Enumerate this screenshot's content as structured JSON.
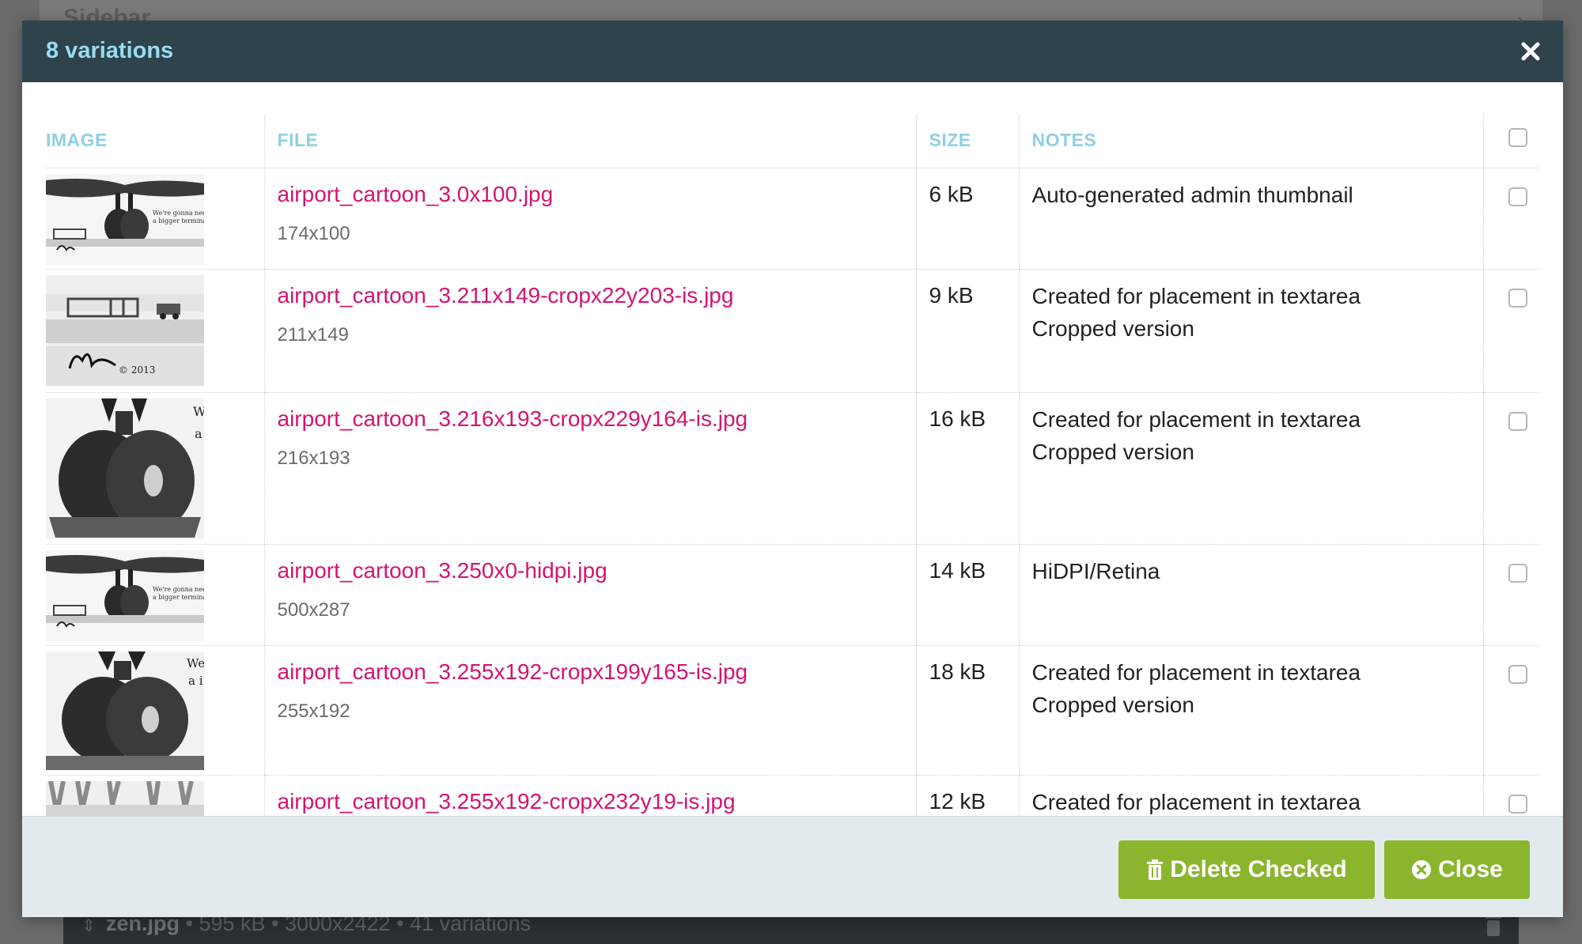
{
  "background": {
    "sidebar_label": "Sidebar",
    "file_name": "zen.jpg",
    "file_meta": "• 595 kB • 3000x2422 • 41 variations"
  },
  "modal": {
    "title": "8 variations",
    "columns": {
      "image": "IMAGE",
      "file": "FILE",
      "size": "SIZE",
      "notes": "NOTES"
    },
    "rows": [
      {
        "file": "airport_cartoon_3.0x100.jpg",
        "dims": "174x100",
        "size": "6 kB",
        "note1": "Auto-generated admin thumbnail",
        "note2": ""
      },
      {
        "file": "airport_cartoon_3.211x149-cropx22y203-is.jpg",
        "dims": "211x149",
        "size": "9 kB",
        "note1": "Created for placement in textarea",
        "note2": "Cropped version"
      },
      {
        "file": "airport_cartoon_3.216x193-cropx229y164-is.jpg",
        "dims": "216x193",
        "size": "16 kB",
        "note1": "Created for placement in textarea",
        "note2": "Cropped version"
      },
      {
        "file": "airport_cartoon_3.250x0-hidpi.jpg",
        "dims": "500x287",
        "size": "14 kB",
        "note1": "HiDPI/Retina",
        "note2": ""
      },
      {
        "file": "airport_cartoon_3.255x192-cropx199y165-is.jpg",
        "dims": "255x192",
        "size": "18 kB",
        "note1": "Created for placement in textarea",
        "note2": "Cropped version"
      },
      {
        "file": "airport_cartoon_3.255x192-cropx232y19-is.jpg",
        "dims": "",
        "size": "12 kB",
        "note1": "Created for placement in textarea",
        "note2": ""
      }
    ],
    "buttons": {
      "delete": "Delete Checked",
      "close": "Close"
    }
  },
  "thumbnail_texts": {
    "caption_wide": "We're gonna need a bigger terminal.",
    "signature": "© 2013",
    "crop_letters_a": "W",
    "crop_letters_b": "a",
    "crop_letters_c": "We",
    "crop_letters_d": "a i"
  },
  "colors": {
    "header_bg": "#2f434d",
    "title": "#98ddf0",
    "column_header": "#8ecfe3",
    "link": "#d31470",
    "button": "#8bb52d",
    "footer_bg": "#e3eaee"
  },
  "icons": {
    "close": "close-icon",
    "trash": "trash-icon",
    "times_circle": "times-circle-icon",
    "sort": "sort-icon"
  }
}
